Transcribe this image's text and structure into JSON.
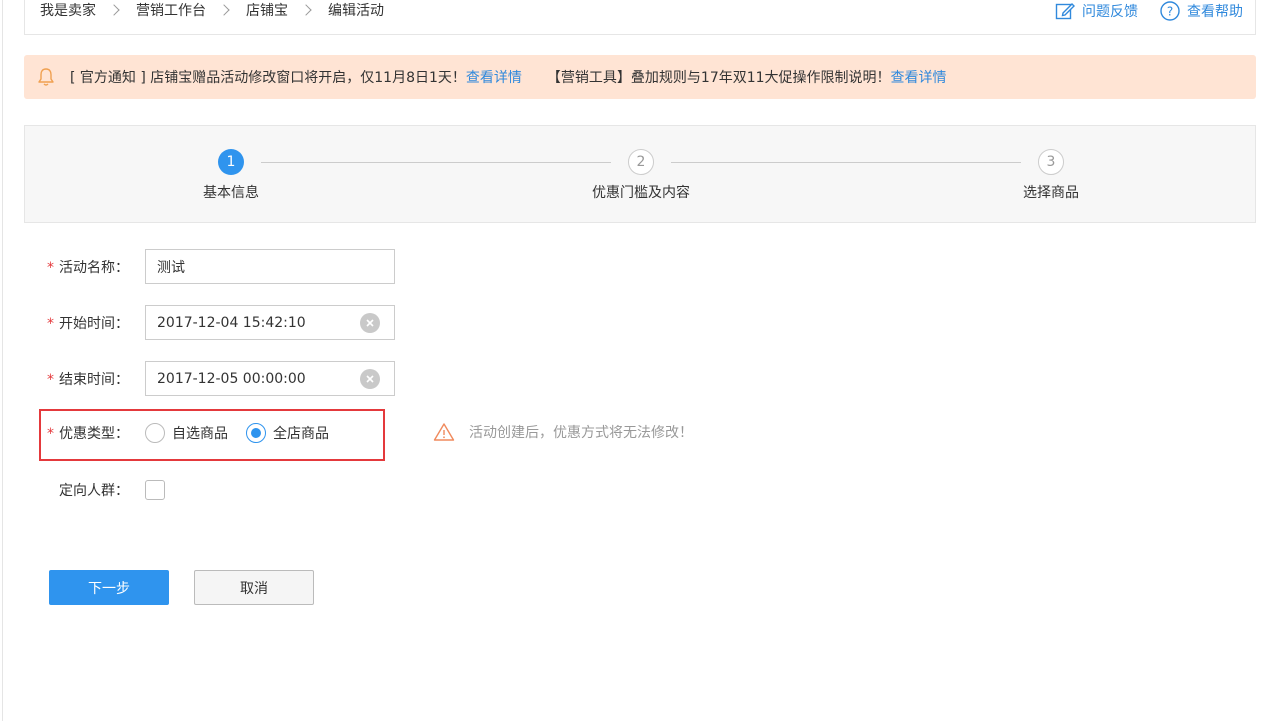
{
  "breadcrumb": {
    "items": [
      "我是卖家",
      "营销工作台",
      "店铺宝",
      "编辑活动"
    ]
  },
  "header_actions": {
    "feedback": "问题反馈",
    "help": "查看帮助"
  },
  "notice": {
    "text1": "[ 官方通知 ] 店铺宝赠品活动修改窗口将开启，仅11月8日1天！",
    "link1": "查看详情",
    "text2": "【营销工具】叠加规则与17年双11大促操作限制说明！",
    "link2": "查看详情"
  },
  "steps": [
    {
      "number": "1",
      "label": "基本信息",
      "state": "active"
    },
    {
      "number": "2",
      "label": "优惠门槛及内容",
      "state": "todo"
    },
    {
      "number": "3",
      "label": "选择商品",
      "state": "todo"
    }
  ],
  "form": {
    "required_mark": "*",
    "name": {
      "label": "活动名称：",
      "value": "测试"
    },
    "start": {
      "label": "开始时间：",
      "value": "2017-12-04 15:42:10"
    },
    "end": {
      "label": "结束时间：",
      "value": "2017-12-05 00:00:00"
    },
    "discount_type": {
      "label": "优惠类型：",
      "options": [
        "自选商品",
        "全店商品"
      ],
      "selected": "全店商品"
    },
    "warning": "活动创建后，优惠方式将无法修改！",
    "target": {
      "label": "定向人群：",
      "checked": false
    }
  },
  "buttons": {
    "next": "下一步",
    "cancel": "取消"
  },
  "colors": {
    "primary": "#2f94ee",
    "link": "#3089dc",
    "required": "#e4393c",
    "notice_bg": "#ffe4d4",
    "warning_icon": "#f08a5d"
  }
}
